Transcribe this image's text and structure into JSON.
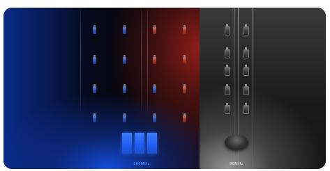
{
  "left_panel": {
    "label": "160MHz",
    "bar_count": 3,
    "colors": {
      "accent": "#1f5df2",
      "warm_glow": "#9c3a2a"
    }
  },
  "right_panel": {
    "label": "80MHz",
    "colors": {
      "accent": "#d9d9d9"
    }
  }
}
